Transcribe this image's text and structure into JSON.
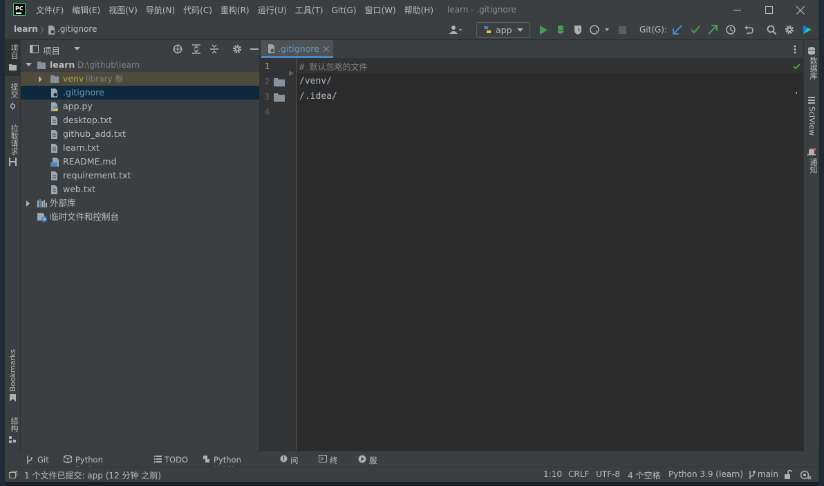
{
  "titlebar": {
    "logo": "PC",
    "menu": [
      "文件(F)",
      "编辑(E)",
      "视图(V)",
      "导航(N)",
      "代码(C)",
      "重构(R)",
      "运行(U)",
      "工具(T)",
      "Git(G)",
      "窗口(W)",
      "帮助(H)"
    ],
    "window_title": "learn - .gitignore"
  },
  "navbar": {
    "crumb_project": "learn",
    "crumb_file": ".gitignore",
    "run_config": "app",
    "git_label": "Git(G):"
  },
  "left_tools": {
    "project": "项目",
    "commit": "提交",
    "pull_requests": "拉取请求",
    "bookmarks": "Bookmarks",
    "structure": "结构"
  },
  "right_tools": {
    "database": "数据库",
    "sciview": "SciView",
    "notifications": "通知"
  },
  "project_panel": {
    "title": "项目",
    "tree": [
      {
        "label": "learn",
        "path": "D:\\github\\learn"
      },
      {
        "label": "venv",
        "suffix": "library 根"
      },
      {
        "label": ".gitignore"
      },
      {
        "label": "app.py"
      },
      {
        "label": "desktop.txt"
      },
      {
        "label": "github_add.txt"
      },
      {
        "label": "learn.txt"
      },
      {
        "label": "README.md"
      },
      {
        "label": "requirement.txt"
      },
      {
        "label": "web.txt"
      },
      {
        "label": "外部库"
      },
      {
        "label": "临时文件和控制台"
      }
    ]
  },
  "editor": {
    "tab_label": ".gitignore",
    "line_numbers": [
      "1",
      "2",
      "3",
      "4"
    ],
    "lines": [
      "# 默认忽略的文件",
      "/venv/",
      "/.idea/",
      ""
    ]
  },
  "bottom_tools": [
    "Git",
    "Python Packages",
    "TODO",
    "Python 控制台",
    "问题",
    "终端",
    "服务"
  ],
  "status": {
    "message": "1 个文件已提交: app (12 分钟 之前)",
    "position": "1:10",
    "line_sep": "CRLF",
    "encoding": "UTF-8",
    "indent": "4 个空格",
    "interpreter": "Python 3.9 (learn)",
    "branch": "main"
  },
  "colors": {
    "accent": "#4a88c7",
    "green": "#499c54",
    "folder": "#87939a",
    "excluded_text": "#b6a73c"
  }
}
